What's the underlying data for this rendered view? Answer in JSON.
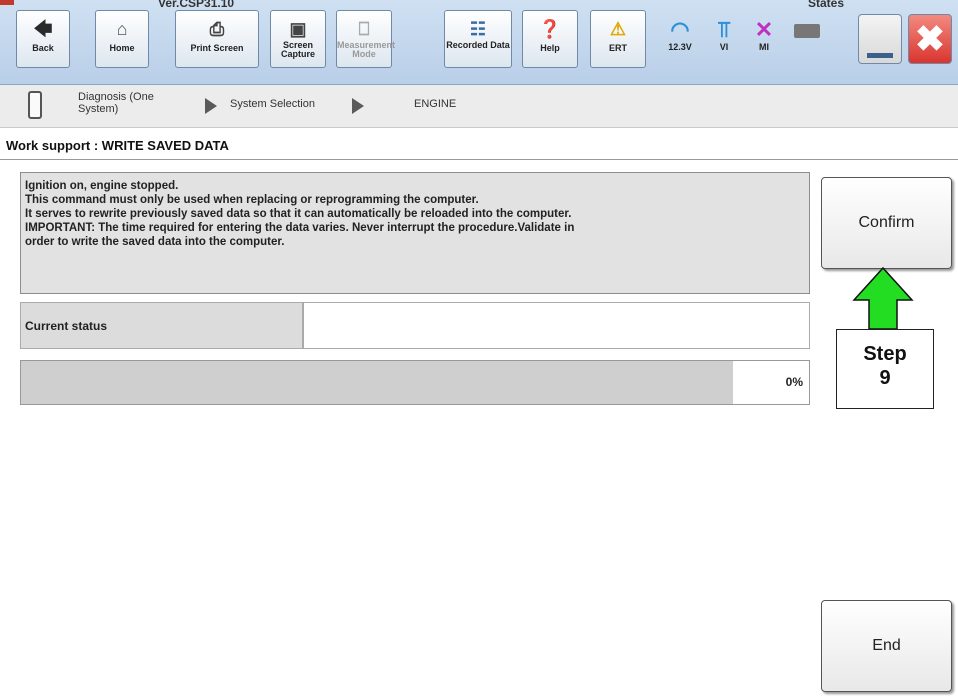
{
  "header": {
    "version": "Ver.CSP31.10",
    "states_label": "States"
  },
  "toolbar": [
    {
      "label": "Back",
      "icon": "back-arrow-icon",
      "enabled": true
    },
    {
      "label": "Home",
      "icon": "home-icon",
      "enabled": true
    },
    {
      "label": "Print Screen",
      "icon": "printer-icon",
      "enabled": true
    },
    {
      "label": "Screen Capture",
      "icon": "camera-icon",
      "enabled": true
    },
    {
      "label": "Measurement Mode",
      "icon": "measurement-icon",
      "enabled": false
    },
    {
      "label": "Recorded Data",
      "icon": "recorded-data-icon",
      "enabled": true
    },
    {
      "label": "Help",
      "icon": "help-icon",
      "enabled": true
    },
    {
      "label": "ERT",
      "icon": "warning-icon",
      "enabled": true
    }
  ],
  "status_indicators": [
    {
      "label": "12.3V",
      "icon": "car-battery-icon"
    },
    {
      "label": "VI",
      "icon": "signal-icon"
    },
    {
      "label": "MI",
      "icon": "mi-x-icon"
    }
  ],
  "breadcrumb": {
    "items": [
      "Diagnosis (One System)",
      "System Selection",
      "ENGINE"
    ]
  },
  "page": {
    "title": "Work support : WRITE SAVED DATA",
    "message_lines": [
      "Ignition on, engine stopped.",
      "This command must only be used when replacing or reprogramming the computer.",
      "It serves to rewrite previously saved data so that it can automatically be reloaded into the computer.",
      "IMPORTANT: The time required for entering the data varies. Never interrupt the procedure.Validate in",
      "order to write the saved data into the computer."
    ],
    "current_status_label": "Current status",
    "current_status_value": "",
    "progress_percent": 0,
    "progress_text": "0%",
    "confirm_label": "Confirm",
    "end_label": "End"
  },
  "annotation": {
    "step_label": "Step",
    "step_number": "9",
    "arrow_color": "#22dd22"
  },
  "colors": {
    "toolbar_bg": "#c4d8ee",
    "close_red": "#d9352f"
  }
}
